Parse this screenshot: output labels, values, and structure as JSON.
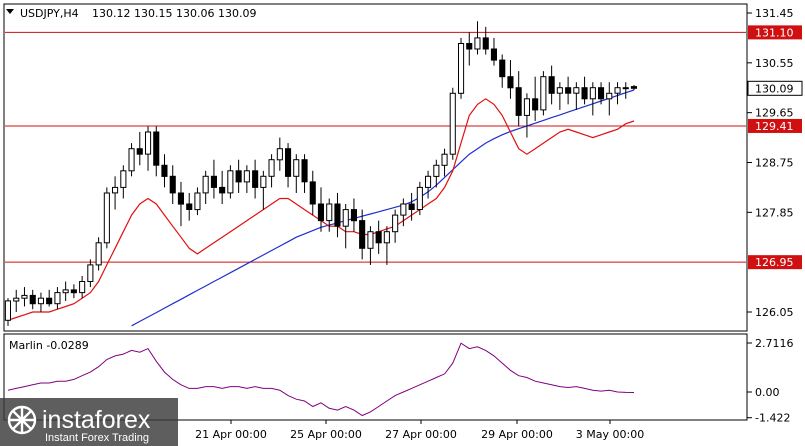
{
  "header": {
    "symbol": "USDJPY,H4",
    "ohlc": "130.12 130.15 130.06 130.09"
  },
  "indicator": {
    "label": "Marlin -0.0289",
    "ticks": [
      "2.7116",
      "0.00",
      "-1.422"
    ]
  },
  "watermark": {
    "brand": "instaforex",
    "tagline": "Instant Forex Trading"
  },
  "colors": {
    "up_candle": "#ffffff",
    "down_candle": "#000000",
    "ma_fast": "#e01010",
    "ma_slow": "#1f2fd0",
    "levels": "#d01010",
    "oscillator": "#800080",
    "price_tag_bg": "#ffffff"
  },
  "chart_data": [
    {
      "type": "candlestick",
      "title": "USDJPY,H4",
      "ylim": [
        125.7,
        131.6
      ],
      "y_ticks": [
        "131.45",
        "130.55",
        "129.65",
        "128.75",
        "127.85",
        "126.05"
      ],
      "x_ticks": [
        "21 Apr 00:00",
        "25 Apr 00:00",
        "27 Apr 00:00",
        "29 Apr 00:00",
        "3 May 00:00"
      ],
      "level_lines": [
        {
          "value": 131.1,
          "label": "131.10"
        },
        {
          "value": 129.41,
          "label": "129.41"
        },
        {
          "value": 126.95,
          "label": "126.95"
        }
      ],
      "current_price": {
        "value": 130.09,
        "label": "130.09"
      },
      "ohlc": [
        [
          125.9,
          126.3,
          125.8,
          126.25
        ],
        [
          126.25,
          126.45,
          126.05,
          126.3
        ],
        [
          126.3,
          126.5,
          126.15,
          126.35
        ],
        [
          126.35,
          126.45,
          126.1,
          126.2
        ],
        [
          126.2,
          126.4,
          126.05,
          126.3
        ],
        [
          126.3,
          126.45,
          126.15,
          126.2
        ],
        [
          126.2,
          126.5,
          126.1,
          126.4
        ],
        [
          126.4,
          126.6,
          126.25,
          126.45
        ],
        [
          126.45,
          126.55,
          126.3,
          126.4
        ],
        [
          126.4,
          126.7,
          126.3,
          126.6
        ],
        [
          126.6,
          127.0,
          126.5,
          126.9
        ],
        [
          126.9,
          127.4,
          126.8,
          127.3
        ],
        [
          127.3,
          128.3,
          127.2,
          128.2
        ],
        [
          128.2,
          128.5,
          127.9,
          128.3
        ],
        [
          128.3,
          128.7,
          128.1,
          128.6
        ],
        [
          128.6,
          129.1,
          128.5,
          129.0
        ],
        [
          129.0,
          129.3,
          128.7,
          128.9
        ],
        [
          128.9,
          129.4,
          128.6,
          129.3
        ],
        [
          129.3,
          129.4,
          128.5,
          128.7
        ],
        [
          128.7,
          128.9,
          128.3,
          128.5
        ],
        [
          128.5,
          128.7,
          128.0,
          128.2
        ],
        [
          128.2,
          128.4,
          127.6,
          128.0
        ],
        [
          128.0,
          128.2,
          127.7,
          127.9
        ],
        [
          127.9,
          128.3,
          127.8,
          128.2
        ],
        [
          128.2,
          128.6,
          128.0,
          128.5
        ],
        [
          128.5,
          128.8,
          128.1,
          128.3
        ],
        [
          128.3,
          128.6,
          128.0,
          128.2
        ],
        [
          128.2,
          128.7,
          128.1,
          128.6
        ],
        [
          128.6,
          128.8,
          128.2,
          128.4
        ],
        [
          128.4,
          128.7,
          128.2,
          128.6
        ],
        [
          128.6,
          128.8,
          128.1,
          128.3
        ],
        [
          128.3,
          128.6,
          127.9,
          128.5
        ],
        [
          128.5,
          128.9,
          128.3,
          128.8
        ],
        [
          128.8,
          129.2,
          128.6,
          129.0
        ],
        [
          129.0,
          129.1,
          128.3,
          128.5
        ],
        [
          128.5,
          128.9,
          128.2,
          128.8
        ],
        [
          128.8,
          128.9,
          128.2,
          128.4
        ],
        [
          128.4,
          128.6,
          127.8,
          128.0
        ],
        [
          128.0,
          128.3,
          127.5,
          127.7
        ],
        [
          127.7,
          128.1,
          127.5,
          128.0
        ],
        [
          128.0,
          128.2,
          127.4,
          127.6
        ],
        [
          127.6,
          128.0,
          127.2,
          127.9
        ],
        [
          127.9,
          128.1,
          127.5,
          127.7
        ],
        [
          127.7,
          127.9,
          127.0,
          127.2
        ],
        [
          127.2,
          127.6,
          126.9,
          127.5
        ],
        [
          127.5,
          127.7,
          127.1,
          127.3
        ],
        [
          127.3,
          127.6,
          126.9,
          127.5
        ],
        [
          127.5,
          127.9,
          127.3,
          127.8
        ],
        [
          127.8,
          128.1,
          127.6,
          128.0
        ],
        [
          128.0,
          128.2,
          127.7,
          127.9
        ],
        [
          127.9,
          128.4,
          127.8,
          128.3
        ],
        [
          128.3,
          128.6,
          128.1,
          128.5
        ],
        [
          128.5,
          128.8,
          128.3,
          128.7
        ],
        [
          128.7,
          129.0,
          128.5,
          128.9
        ],
        [
          128.9,
          130.1,
          128.8,
          130.0
        ],
        [
          130.0,
          131.0,
          129.9,
          130.9
        ],
        [
          130.9,
          131.1,
          130.5,
          130.8
        ],
        [
          130.8,
          131.3,
          130.7,
          131.0
        ],
        [
          131.0,
          131.2,
          130.7,
          130.8
        ],
        [
          130.8,
          131.0,
          130.5,
          130.6
        ],
        [
          130.6,
          130.7,
          130.1,
          130.3
        ],
        [
          130.3,
          130.6,
          129.9,
          130.1
        ],
        [
          130.1,
          130.4,
          129.4,
          129.6
        ],
        [
          129.6,
          130.0,
          129.2,
          129.9
        ],
        [
          129.9,
          130.3,
          129.5,
          129.7
        ],
        [
          129.7,
          130.4,
          129.6,
          130.3
        ],
        [
          130.3,
          130.5,
          129.8,
          130.0
        ],
        [
          130.0,
          130.2,
          129.7,
          130.1
        ],
        [
          130.1,
          130.3,
          129.8,
          130.0
        ],
        [
          130.0,
          130.2,
          129.7,
          130.1
        ],
        [
          130.1,
          130.3,
          129.8,
          129.9
        ],
        [
          129.9,
          130.2,
          129.6,
          130.1
        ],
        [
          130.1,
          130.2,
          129.8,
          129.9
        ],
        [
          129.9,
          130.2,
          129.6,
          130.0
        ],
        [
          130.0,
          130.2,
          129.8,
          130.1
        ],
        [
          130.1,
          130.2,
          129.9,
          130.1
        ],
        [
          130.12,
          130.15,
          130.06,
          130.09
        ]
      ],
      "ma_fast": [
        125.9,
        125.95,
        126.0,
        126.05,
        126.05,
        126.05,
        126.1,
        126.15,
        126.2,
        126.3,
        126.4,
        126.6,
        126.9,
        127.2,
        127.5,
        127.8,
        128.0,
        128.1,
        128.0,
        127.8,
        127.6,
        127.4,
        127.2,
        127.1,
        127.2,
        127.3,
        127.4,
        127.5,
        127.6,
        127.7,
        127.8,
        127.9,
        128.0,
        128.1,
        128.1,
        128.0,
        127.9,
        127.8,
        127.7,
        127.6,
        127.6,
        127.5,
        127.5,
        127.45,
        127.45,
        127.5,
        127.55,
        127.6,
        127.7,
        127.8,
        127.9,
        128.0,
        128.1,
        128.3,
        128.6,
        129.1,
        129.6,
        129.8,
        129.9,
        129.8,
        129.6,
        129.3,
        129.0,
        128.9,
        129.0,
        129.1,
        129.2,
        129.3,
        129.35,
        129.3,
        129.25,
        129.2,
        129.25,
        129.3,
        129.35,
        129.45,
        129.5
      ],
      "ma_slow": [
        null,
        null,
        null,
        null,
        null,
        null,
        null,
        null,
        null,
        null,
        null,
        null,
        null,
        null,
        null,
        125.8,
        125.88,
        125.96,
        126.04,
        126.12,
        126.2,
        126.28,
        126.36,
        126.44,
        126.52,
        126.6,
        126.68,
        126.76,
        126.84,
        126.92,
        127.0,
        127.08,
        127.16,
        127.24,
        127.32,
        127.4,
        127.46,
        127.52,
        127.58,
        127.62,
        127.66,
        127.7,
        127.74,
        127.78,
        127.82,
        127.86,
        127.9,
        127.94,
        127.98,
        128.04,
        128.12,
        128.22,
        128.34,
        128.48,
        128.62,
        128.76,
        128.9,
        129.0,
        129.1,
        129.18,
        129.25,
        129.31,
        129.36,
        129.41,
        129.46,
        129.51,
        129.56,
        129.61,
        129.66,
        129.71,
        129.76,
        129.81,
        129.86,
        129.91,
        129.96,
        130.01,
        130.06
      ]
    },
    {
      "type": "line",
      "title": "Marlin -0.0289",
      "ylim": [
        -1.8,
        3.2
      ],
      "y_ticks": [
        "2.7116",
        "0.00",
        "-1.422"
      ],
      "series": [
        {
          "values": [
            0.1,
            0.2,
            0.3,
            0.4,
            0.5,
            0.5,
            0.6,
            0.6,
            0.7,
            0.9,
            1.1,
            1.4,
            1.8,
            2.0,
            2.1,
            2.3,
            2.2,
            2.4,
            1.7,
            1.1,
            0.7,
            0.4,
            0.2,
            0.2,
            0.3,
            0.3,
            0.2,
            0.3,
            0.3,
            0.2,
            0.3,
            0.2,
            0.2,
            0.1,
            -0.2,
            -0.4,
            -0.5,
            -0.8,
            -0.6,
            -0.9,
            -1.0,
            -0.8,
            -1.0,
            -1.3,
            -1.1,
            -0.8,
            -0.5,
            -0.2,
            0.0,
            0.2,
            0.4,
            0.6,
            0.8,
            1.0,
            1.6,
            2.7,
            2.4,
            2.5,
            2.3,
            2.0,
            1.6,
            1.2,
            0.9,
            0.8,
            0.6,
            0.5,
            0.4,
            0.3,
            0.25,
            0.3,
            0.2,
            0.1,
            0.05,
            0.1,
            0.0,
            -0.02,
            -0.03
          ]
        }
      ]
    }
  ]
}
